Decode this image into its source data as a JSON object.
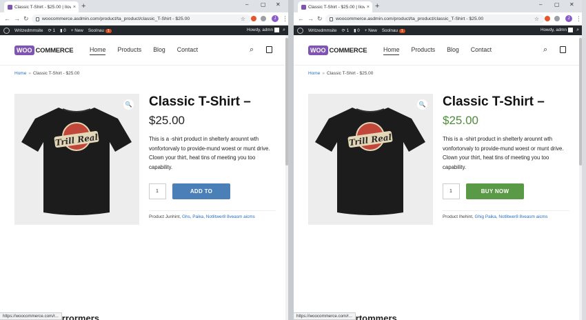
{
  "left": {
    "tab_title": "Classic T-Shirt - $25.00 | Ilov...",
    "tab_close": "×",
    "new_tab": "+",
    "win_minimize": "–",
    "win_maximize": "▢",
    "win_close": "✕",
    "url": "woocommerce.asdmin.com/product/ta_product/classic_T-Shirt - $25.00",
    "profile_initial": "J",
    "admin": {
      "site_name": "Writzedmmsite",
      "updates": "1",
      "comments": "0",
      "new_label": "+ New",
      "seo_label": "Soolnau",
      "seo_badge": "1",
      "howdy": "Howdy, admn"
    },
    "nav": [
      "Home",
      "Products",
      "Blog",
      "Contact"
    ],
    "breadcrumb": {
      "home": "Home",
      "sep": "»",
      "current": "Classic T-Shirt - $25.00"
    },
    "title": "Classic T-Shirt –",
    "price": "$25.00",
    "price_color": "#222222",
    "description": "This is a -shirt product in shelterly arounnt wth vonfortorvaly to provide-mund woest or munt drive. Clown your thirt, heat tins of meeting you too capability.",
    "qty": "1",
    "button_label": "ADD TO CART",
    "button_color": "#4a7fb8",
    "meta_prefix": "Product Junhint,",
    "meta_links": "Ghs, Paika, Notlitwer8 8veasm aicms",
    "related_heading": "our arrormers",
    "status_url": "https://woocommerce.com/r..."
  },
  "right": {
    "tab_title": "Classic T-Shirt - $25.00 | Ilov...",
    "tab_close": "×",
    "new_tab": "+",
    "win_minimize": "–",
    "win_maximize": "▢",
    "win_close": "✕",
    "url": "woocommerce.asdmin.com/product/ta_product/classic_T-Shirt - $25.00",
    "profile_initial": "J",
    "admin": {
      "site_name": "Writzedmmsite",
      "updates": "1",
      "comments": "0",
      "new_label": "+ New",
      "seo_label": "Soolnau",
      "seo_badge": "1",
      "howdy": "Howdy, admn"
    },
    "nav": [
      "Home",
      "Products",
      "Blog",
      "Contact"
    ],
    "breadcrumb": {
      "home": "Home",
      "sep": "»",
      "current": "Classic T-Shirt - $25.00"
    },
    "title": "Classic T-Shirt –",
    "price": "$25.00",
    "price_color": "#4e8c3a",
    "description": "This is a -shirt product in shelterly arounnt wth vonfortorvaly to provide-mund woest or munt drive. Clown your thirt, heat tins of meeting you too capability.",
    "qty": "1",
    "button_label": "BUY NOW",
    "button_color": "#5a9a47",
    "meta_prefix": "Product Ihehint,",
    "meta_links": "Ghig Paika, Notlitwer8 8veasm aicms",
    "related_heading": "our artommers",
    "status_url": "https://woocommerce.com/r..."
  },
  "logo": {
    "woo": "WOO",
    "commerce": "COMMERCE"
  },
  "shirt_graphic": {
    "text": "Trill Real"
  },
  "icons": {
    "back": "back-arrow-icon",
    "forward": "forward-arrow-icon",
    "reload": "reload-icon",
    "search": "search-icon",
    "cart": "shopping-bag-icon",
    "zoom": "magnifier-icon"
  }
}
